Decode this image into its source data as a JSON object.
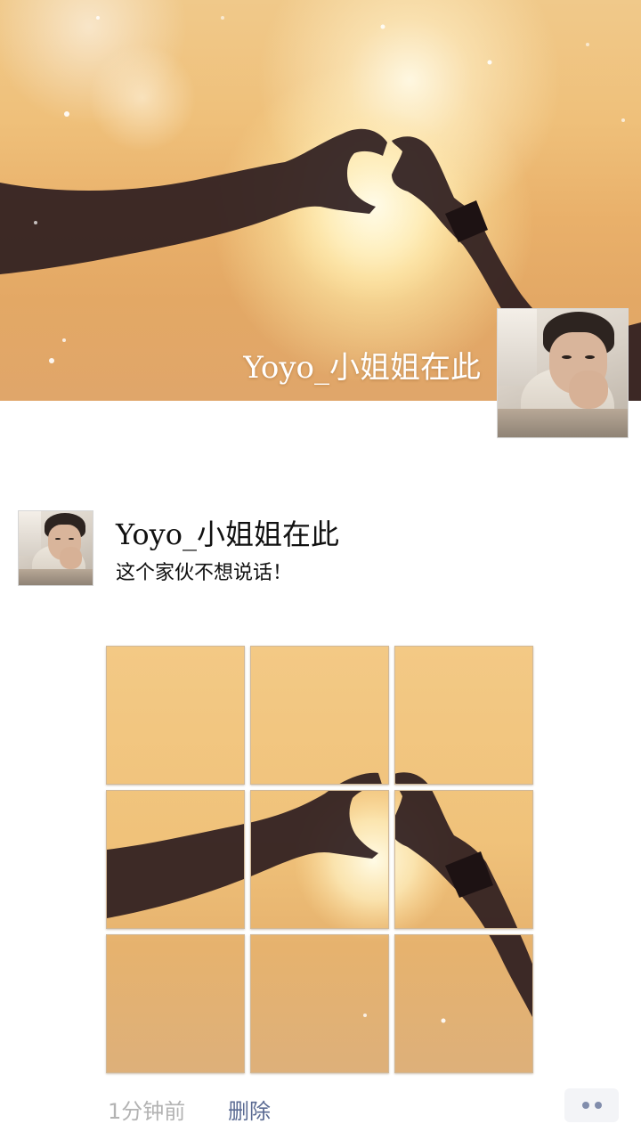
{
  "cover": {
    "user_name": "Yoyo_小姐姐在此",
    "image": "sunset-heart-hands-photo"
  },
  "post": {
    "user_name": "Yoyo_小姐姐在此",
    "text": "这个家伙不想说话！",
    "image_count": 9,
    "timestamp": "1分钟前",
    "delete_label": "删除",
    "more_icon": "more-dots-icon"
  },
  "colors": {
    "link": "#5b6b93",
    "timestamp": "#b3b3b3",
    "sky": "#efc07a"
  }
}
